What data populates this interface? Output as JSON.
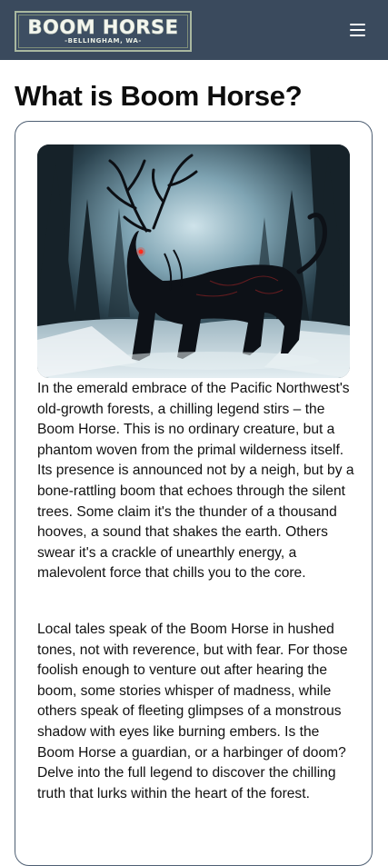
{
  "header": {
    "logo_title": "BOOM HORSE",
    "logo_subtitle": "-BELLINGHAM, WA-",
    "menu_icon": "hamburger-menu-icon"
  },
  "main": {
    "title": "What is Boom Horse?",
    "hero_image": "Dark antlered horse creature standing in a snowy forest",
    "paragraphs": [
      "In the emerald embrace of the Pacific Northwest's old-growth forests, a chilling legend stirs – the Boom Horse. This is no ordinary creature, but a phantom woven from the primal wilderness itself. Its presence is announced not by a neigh, but by a bone-rattling boom that echoes through the silent trees. Some claim it's the thunder of a thousand hooves, a sound that shakes the earth. Others swear it's a crackle of unearthly energy, a malevolent force that chills you to the core.",
      "Local tales speak of the Boom Horse in hushed tones, not with reverence, but with fear. For those foolish enough to venture out after hearing the boom, some stories whisper of madness, while others speak of fleeting glimpses of a monstrous shadow with eyes like burning embers. Is the Boom Horse a guardian, or a harbinger of doom? Delve into the full legend to discover the chilling truth that lurks within the heart of the forest."
    ]
  },
  "colors": {
    "header_bg": "#3a4a5d",
    "card_border": "#4e5f73",
    "eye_glow": "#ff2a1a"
  }
}
